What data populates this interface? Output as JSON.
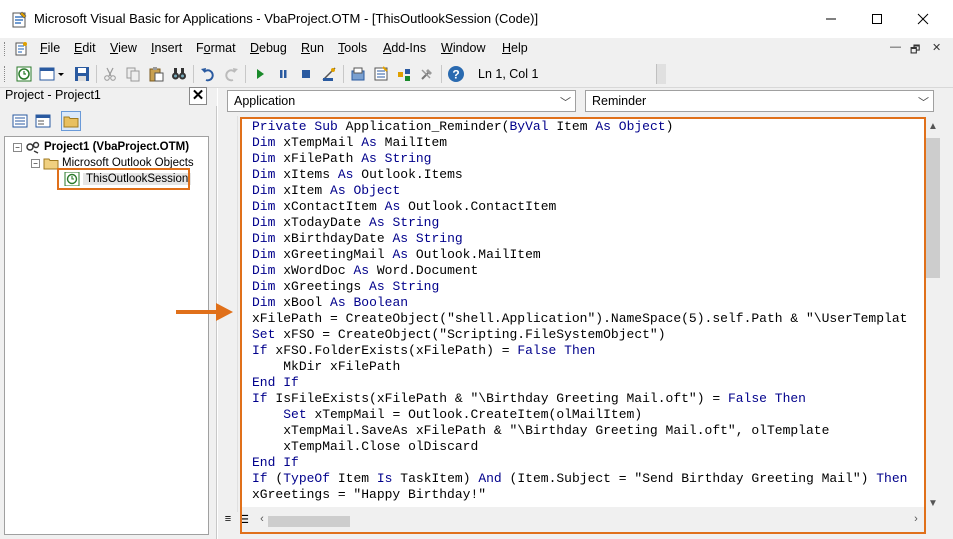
{
  "window": {
    "title": "Microsoft Visual Basic for Applications - VbaProject.OTM - [ThisOutlookSession (Code)]",
    "minimize_icon": "minimize-icon",
    "maximize_icon": "maximize-icon",
    "close_icon": "close-icon"
  },
  "menu": {
    "items": [
      {
        "label": "File",
        "u": "F",
        "rest": "ile"
      },
      {
        "label": "Edit",
        "u": "E",
        "rest": "dit"
      },
      {
        "label": "View",
        "u": "V",
        "rest": "iew"
      },
      {
        "label": "Insert",
        "u": "I",
        "rest": "nsert"
      },
      {
        "label": "Format",
        "u": "",
        "rest": "Format"
      },
      {
        "label": "Debug",
        "u": "D",
        "rest": "ebug"
      },
      {
        "label": "Run",
        "u": "R",
        "rest": "un"
      },
      {
        "label": "Tools",
        "u": "T",
        "rest": "ools"
      },
      {
        "label": "Add-Ins",
        "u": "A",
        "rest": "dd-Ins"
      },
      {
        "label": "Window",
        "u": "W",
        "rest": "indow"
      },
      {
        "label": "Help",
        "u": "H",
        "rest": "elp"
      }
    ]
  },
  "toolbar": {
    "position": "Ln 1, Col 1"
  },
  "project": {
    "title": "Project - Project1",
    "tree": {
      "root": "Project1 (VbaProject.OTM)",
      "folder": "Microsoft Outlook Objects",
      "item": "ThisOutlookSession"
    }
  },
  "code": {
    "object_combo": "Application",
    "procedure_combo": "Reminder",
    "lines": [
      "Private Sub Application_Reminder(ByVal Item As Object)",
      "Dim xTempMail As MailItem",
      "Dim xFilePath As String",
      "Dim xItems As Outlook.Items",
      "Dim xItem As Object",
      "Dim xContactItem As Outlook.ContactItem",
      "Dim xTodayDate As String",
      "Dim xBirthdayDate As String",
      "Dim xGreetingMail As Outlook.MailItem",
      "Dim xWordDoc As Word.Document",
      "Dim xGreetings As String",
      "Dim xBool As Boolean",
      "xFilePath = CreateObject(\"shell.Application\").NameSpace(5).self.Path & \"\\UserTemplat",
      "Set xFSO = CreateObject(\"Scripting.FileSystemObject\")",
      "If xFSO.FolderExists(xFilePath) = False Then",
      "    MkDir xFilePath",
      "End If",
      "If IsFileExists(xFilePath & \"\\Birthday Greeting Mail.oft\") = False Then",
      "    Set xTempMail = Outlook.CreateItem(olMailItem)",
      "    xTempMail.SaveAs xFilePath & \"\\Birthday Greeting Mail.oft\", olTemplate",
      "    xTempMail.Close olDiscard",
      "End If",
      "If (TypeOf Item Is TaskItem) And (Item.Subject = \"Send Birthday Greeting Mail\") Then",
      "xGreetings = \"Happy Birthday!\""
    ]
  },
  "colors": {
    "keyword": "#00008b",
    "highlight": "#e0701a"
  }
}
